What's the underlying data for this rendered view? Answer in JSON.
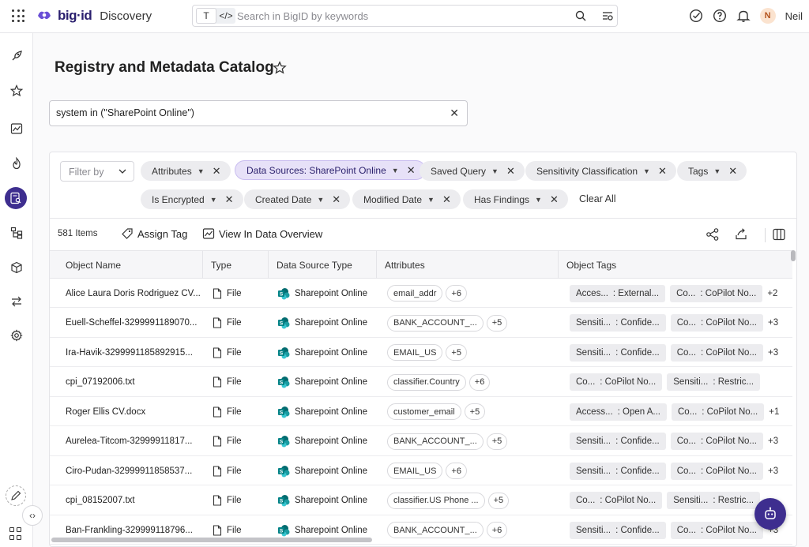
{
  "app": {
    "brand": "big·id",
    "name": "Discovery"
  },
  "search": {
    "placeholder": "Search in BigID by keywords",
    "mode_text": "T",
    "mode_code": "</>"
  },
  "user": {
    "initial": "N",
    "name": "Neil"
  },
  "page": {
    "title": "Registry and Metadata Catalog"
  },
  "query": {
    "value": "system in (\"SharePoint Online\")"
  },
  "filters": {
    "filter_by_placeholder": "Filter by",
    "chips": [
      {
        "label": "Attributes",
        "selected": false
      },
      {
        "label": "Data Sources: SharePoint Online",
        "selected": true
      },
      {
        "label": "Saved Query",
        "selected": false
      },
      {
        "label": "Sensitivity Classification",
        "selected": false
      },
      {
        "label": "Tags",
        "selected": false
      },
      {
        "label": "Is Encrypted",
        "selected": false
      },
      {
        "label": "Created Date",
        "selected": false
      },
      {
        "label": "Modified Date",
        "selected": false
      },
      {
        "label": "Has Findings",
        "selected": false
      }
    ],
    "clear_all": "Clear All"
  },
  "toolbar": {
    "count": "581 Items",
    "assign_tag": "Assign Tag",
    "view_overview": "View In Data Overview"
  },
  "table": {
    "columns": [
      "Object Name",
      "Type",
      "Data Source Type",
      "Attributes",
      "Object Tags"
    ],
    "rows": [
      {
        "name": "Alice Laura Doris Rodriguez CV...",
        "type": "File",
        "source": "Sharepoint Online",
        "attr": "email_addr",
        "attr_more": "+6",
        "tags": [
          [
            "Acces...",
            ": External..."
          ],
          [
            "Co...",
            ": CoPilot No..."
          ]
        ],
        "tag_more": "+2"
      },
      {
        "name": "Euell-Scheffel-3299991189070...",
        "type": "File",
        "source": "Sharepoint Online",
        "attr": "BANK_ACCOUNT_...",
        "attr_more": "+5",
        "tags": [
          [
            "Sensiti...",
            ": Confide..."
          ],
          [
            "Co...",
            ": CoPilot No..."
          ]
        ],
        "tag_more": "+3"
      },
      {
        "name": "Ira-Havik-3299991185892915...",
        "type": "File",
        "source": "Sharepoint Online",
        "attr": "EMAIL_US",
        "attr_more": "+5",
        "tags": [
          [
            "Sensiti...",
            ": Confide..."
          ],
          [
            "Co...",
            ": CoPilot No..."
          ]
        ],
        "tag_more": "+3"
      },
      {
        "name": "cpi_07192006.txt",
        "type": "File",
        "source": "Sharepoint Online",
        "attr": "classifier.Country",
        "attr_more": "+6",
        "tags": [
          [
            "Co...",
            ": CoPilot No..."
          ],
          [
            "Sensiti...",
            ": Restric..."
          ]
        ],
        "tag_more": ""
      },
      {
        "name": "Roger Ellis CV.docx",
        "type": "File",
        "source": "Sharepoint Online",
        "attr": "customer_email",
        "attr_more": "+5",
        "tags": [
          [
            "Access...",
            ": Open A..."
          ],
          [
            "Co...",
            ": CoPilot No..."
          ]
        ],
        "tag_more": "+1"
      },
      {
        "name": "Aurelea-Titcom-32999911817...",
        "type": "File",
        "source": "Sharepoint Online",
        "attr": "BANK_ACCOUNT_...",
        "attr_more": "+5",
        "tags": [
          [
            "Sensiti...",
            ": Confide..."
          ],
          [
            "Co...",
            ": CoPilot No..."
          ]
        ],
        "tag_more": "+3"
      },
      {
        "name": "Ciro-Pudan-32999911858537...",
        "type": "File",
        "source": "Sharepoint Online",
        "attr": "EMAIL_US",
        "attr_more": "+6",
        "tags": [
          [
            "Sensiti...",
            ": Confide..."
          ],
          [
            "Co...",
            ": CoPilot No..."
          ]
        ],
        "tag_more": "+3"
      },
      {
        "name": "cpi_08152007.txt",
        "type": "File",
        "source": "Sharepoint Online",
        "attr": "classifier.US Phone ...",
        "attr_more": "+5",
        "tags": [
          [
            "Co...",
            ": CoPilot No..."
          ],
          [
            "Sensiti...",
            ": Restric..."
          ]
        ],
        "tag_more": ""
      },
      {
        "name": "Ban-Frankling-329999118796...",
        "type": "File",
        "source": "Sharepoint Online",
        "attr": "BANK_ACCOUNT_...",
        "attr_more": "+6",
        "tags": [
          [
            "Sensiti...",
            ": Confide..."
          ],
          [
            "Co...",
            ": CoPilot No..."
          ]
        ],
        "tag_more": "+3"
      }
    ]
  },
  "colors": {
    "accent": "#3e2e8f",
    "selected_chip": "#e7e1f8",
    "sharepoint": "#038387"
  },
  "icons": {
    "sidebar": [
      "rocket-icon",
      "star-icon",
      "chart-icon",
      "flame-icon",
      "catalog-icon",
      "hierarchy-icon",
      "cube-icon",
      "transfer-icon",
      "gear-icon"
    ]
  }
}
